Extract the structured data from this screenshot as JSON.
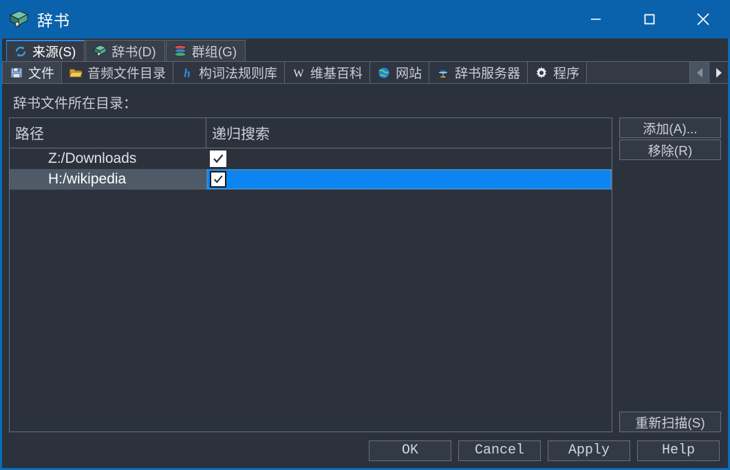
{
  "window": {
    "title": "辞书",
    "icon": "book-icon",
    "controls": {
      "minimize": "minimize-icon",
      "maximize": "maximize-icon",
      "close": "close-icon"
    },
    "accent_color": "#0b62ac",
    "background_color": "#2b323c"
  },
  "tabs": [
    {
      "label": "来源(S)",
      "icon": "refresh-icon",
      "active": true
    },
    {
      "label": "辞书(D)",
      "icon": "book-icon",
      "active": false
    },
    {
      "label": "群组(G)",
      "icon": "books-stack-icon",
      "active": false
    }
  ],
  "subtabs": [
    {
      "label": "文件",
      "icon": "floppy-disk-icon",
      "active": true
    },
    {
      "label": "音频文件目录",
      "icon": "open-folder-icon",
      "active": false
    },
    {
      "label": "构词法规则库",
      "icon": "letter-h-icon",
      "active": false
    },
    {
      "label": "维基百科",
      "icon": "letter-w-icon",
      "active": false
    },
    {
      "label": "网站",
      "icon": "globe-icon",
      "active": false
    },
    {
      "label": "辞书服务器",
      "icon": "server-icon",
      "active": false
    },
    {
      "label": "程序",
      "icon": "gear-icon",
      "active": false
    }
  ],
  "subtab_scroll": {
    "left": "chevron-left-icon",
    "right": "chevron-right-icon"
  },
  "content": {
    "field_label": "辞书文件所在目录：",
    "table": {
      "headers": [
        "路径",
        "递归搜索"
      ],
      "rows": [
        {
          "path": "Z:/Downloads",
          "recursive": true,
          "selected": false
        },
        {
          "path": "H:/wikipedia",
          "recursive": true,
          "selected": true
        }
      ]
    },
    "side_buttons": {
      "add": "添加(A)...",
      "remove": "移除(R)",
      "rescan": "重新扫描(S)"
    }
  },
  "dialog_buttons": [
    {
      "label": "OK"
    },
    {
      "label": "Cancel"
    },
    {
      "label": "Apply"
    },
    {
      "label": "Help"
    }
  ],
  "colors": {
    "selection_blue": "#0c84f2",
    "row_highlight": "#4e5a68",
    "focus_dotted": "#e08a2e",
    "tab_active_underline": "#2a8bf2"
  }
}
